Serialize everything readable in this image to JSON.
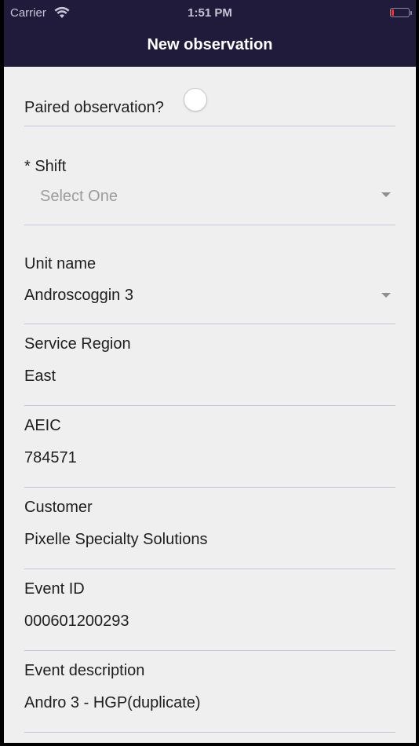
{
  "status_bar": {
    "carrier": "Carrier",
    "time": "1:51 PM",
    "battery_color": "#ff2b2b"
  },
  "nav": {
    "title": "New observation"
  },
  "form": {
    "paired": {
      "label": "Paired observation?",
      "toggle_state": "off"
    },
    "shift": {
      "label": "* Shift",
      "placeholder": "Select One"
    },
    "unit_name": {
      "label": "Unit name",
      "value": "Androscoggin 3"
    },
    "service_region": {
      "label": "Service Region",
      "value": "East"
    },
    "aeic": {
      "label": "AEIC",
      "value": "784571"
    },
    "customer": {
      "label": "Customer",
      "value": "Pixelle Specialty Solutions"
    },
    "event_id": {
      "label": "Event ID",
      "value": "000601200293"
    },
    "event_description": {
      "label": "Event description",
      "value": "Andro 3 - HGP(duplicate)"
    }
  },
  "colors": {
    "nav_background": "#201b3b",
    "content_background": "#efefef",
    "divider": "#c6c6d8"
  }
}
